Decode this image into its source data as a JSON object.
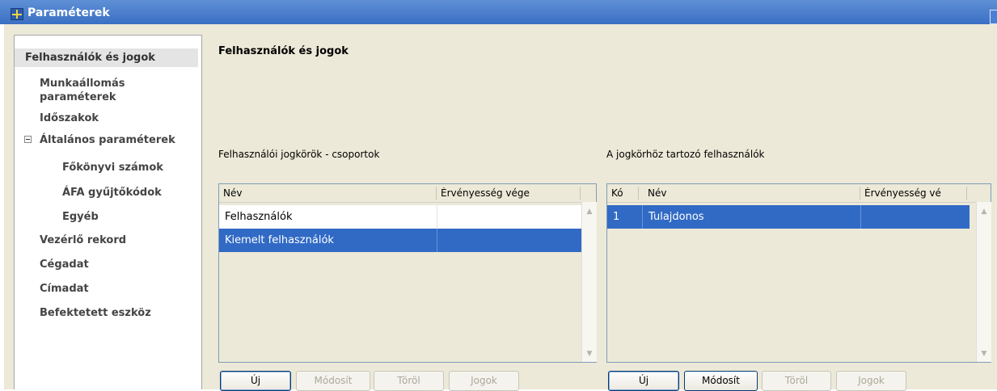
{
  "window": {
    "title": "Paraméterek"
  },
  "sidebar": {
    "items": [
      {
        "label": "Felhasználók és jogok"
      },
      {
        "label": "Munkaállomás"
      },
      {
        "label": "paraméterek"
      },
      {
        "label": "Időszakok"
      },
      {
        "label": "Általános paraméterek"
      },
      {
        "label": "Főkönyvi számok"
      },
      {
        "label": "ÁFA gyűjtőkódok"
      },
      {
        "label": "Egyéb"
      },
      {
        "label": "Vezérlő rekord"
      },
      {
        "label": "Cégadat"
      },
      {
        "label": "Címadat"
      },
      {
        "label": "Befektetett eszköz"
      }
    ]
  },
  "main": {
    "title": "Felhasználók és jogok",
    "groups_panel": {
      "label": "Felhasználói jogkörök - csoportok",
      "columns": [
        "Név",
        "Érvényesség vége"
      ],
      "rows": [
        {
          "name": "Felhasználók",
          "valid_until": ""
        },
        {
          "name": "Kiemelt felhasználók",
          "valid_until": ""
        }
      ],
      "buttons": [
        "Új",
        "Módosít",
        "Töröl",
        "Jogok"
      ]
    },
    "users_panel": {
      "label": "A jogkörhöz tartozó felhasználók",
      "columns": [
        "Kó",
        "Név",
        "Érvényesség vé"
      ],
      "rows": [
        {
          "code": "1",
          "name": "Tulajdonos",
          "valid_until": ""
        }
      ],
      "buttons": [
        "Új",
        "Módosít",
        "Töröl",
        "Jogok"
      ]
    }
  },
  "colors": {
    "titlebar": "#3a6fc4",
    "selection": "#316ac5",
    "panel_bg": "#ece9d8"
  }
}
